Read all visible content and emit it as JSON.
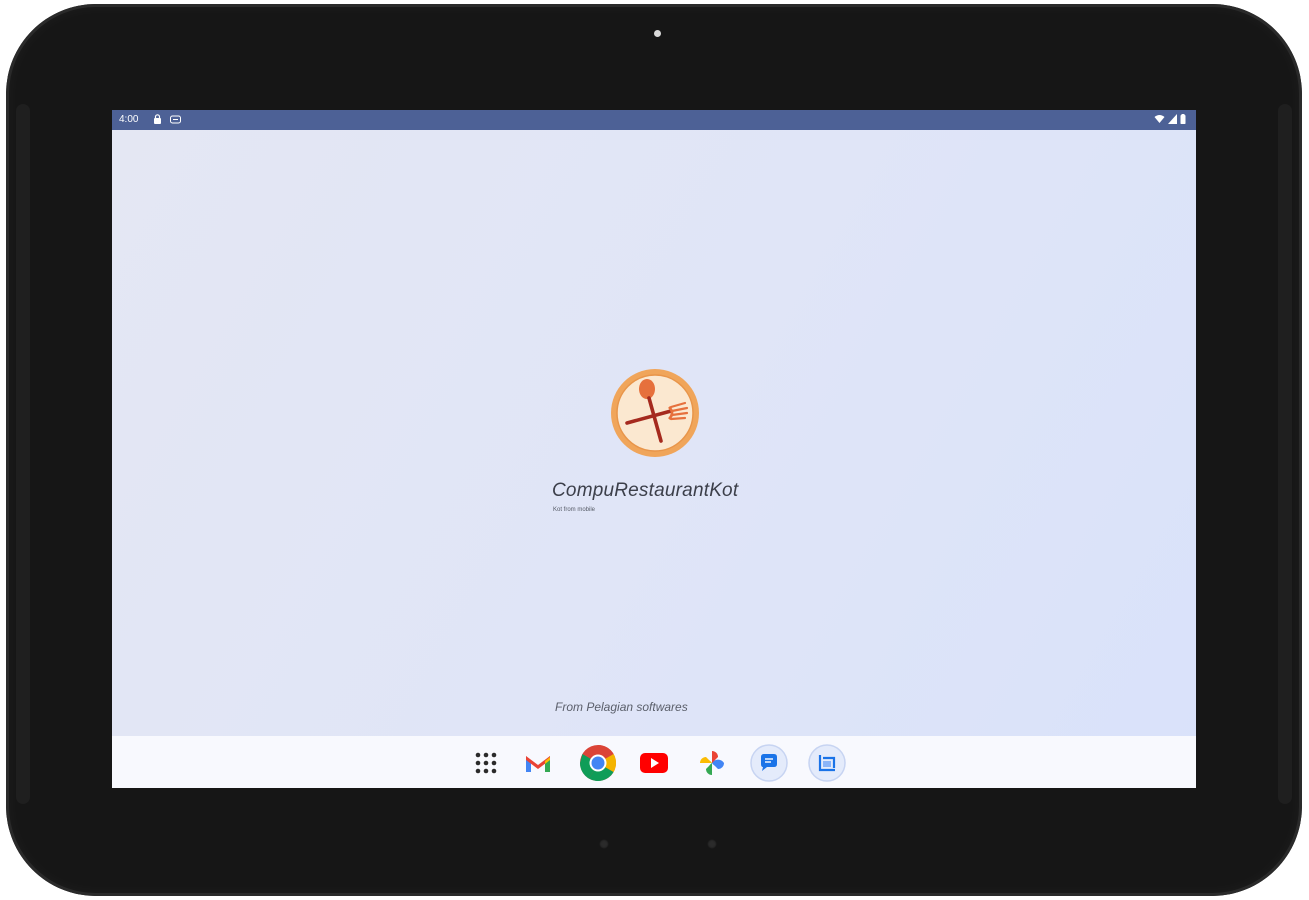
{
  "statusbar": {
    "time": "4:00",
    "left_icons": [
      "lock-icon",
      "notification-icon"
    ],
    "right_icons": [
      "wifi-icon",
      "signal-icon",
      "battery-icon"
    ],
    "background_color": "#4d6196"
  },
  "splash": {
    "app_title": "CompuRestaurantKot",
    "app_subtitle": "Kot from mobile",
    "logo_icon": "spoon-fork-logo",
    "logo_colors": {
      "ring": "#f0a55a",
      "inner": "#fbe8d0",
      "utensils": "#a52a1e"
    },
    "footer": "From Pelagian softwares"
  },
  "taskbar": {
    "apps": [
      {
        "name": "All apps",
        "icon": "app-grid-icon"
      },
      {
        "name": "Gmail",
        "icon": "gmail-icon"
      },
      {
        "name": "Chrome",
        "icon": "chrome-icon"
      },
      {
        "name": "YouTube",
        "icon": "youtube-icon"
      },
      {
        "name": "Photos",
        "icon": "photos-icon"
      },
      {
        "name": "Messages",
        "icon": "messages-icon"
      },
      {
        "name": "Screenshot",
        "icon": "screenshot-icon"
      }
    ]
  }
}
